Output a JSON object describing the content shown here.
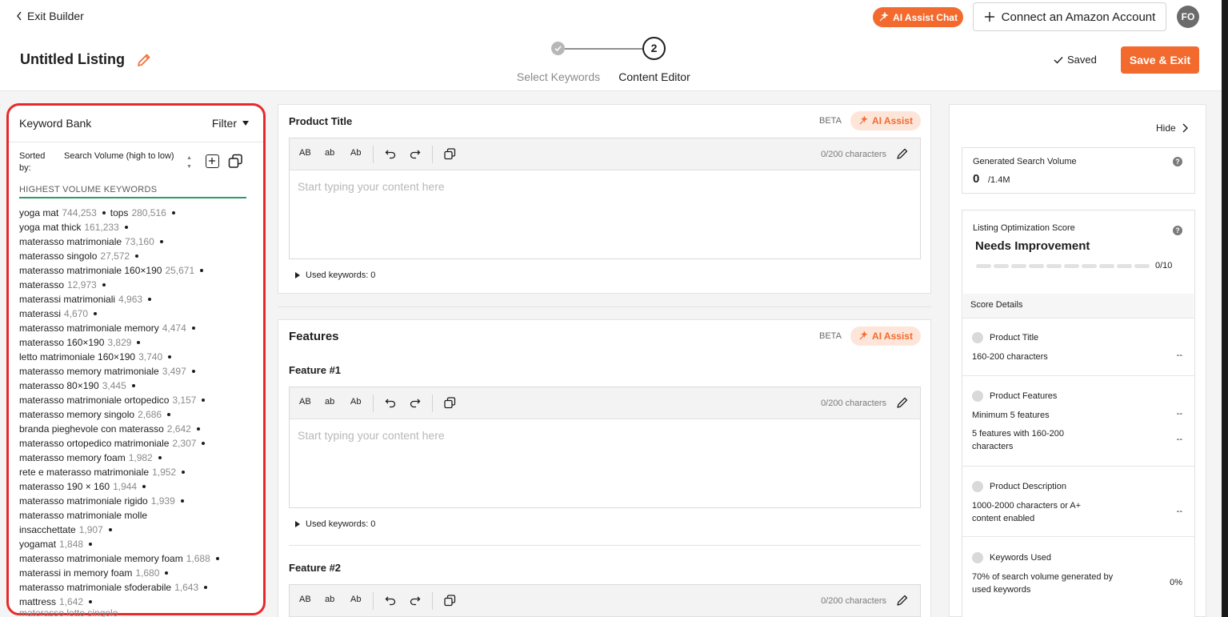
{
  "header": {
    "exit_label": "Exit Builder",
    "listing_title": "Untitled Listing",
    "steps": [
      {
        "label": "Select Keywords"
      },
      {
        "label": "Content Editor",
        "number": "2"
      }
    ],
    "ai_chat_label": "AI Assist Chat",
    "connect_label": "Connect an Amazon Account",
    "avatar_initials": "FO",
    "saved_label": "Saved",
    "save_exit_label": "Save & Exit"
  },
  "colors": {
    "accent": "#f26a2e",
    "highlight_border": "#e8292c",
    "green_rule": "#2e9a6a"
  },
  "keyword_bank": {
    "title": "Keyword Bank",
    "filter_label": "Filter",
    "sorted_by_label": "Sorted by:",
    "sorted_by_value": "Search Volume (high to low)",
    "section_label": "HIGHEST VOLUME KEYWORDS",
    "rows": [
      [
        {
          "kw": "yoga mat",
          "vol": "744,253"
        },
        {
          "kw": "tops",
          "vol": "280,516"
        }
      ],
      [
        {
          "kw": "yoga mat thick",
          "vol": "161,233"
        }
      ],
      [
        {
          "kw": "materasso matrimoniale",
          "vol": "73,160"
        }
      ],
      [
        {
          "kw": "materasso singolo",
          "vol": "27,572"
        }
      ],
      [
        {
          "kw": "materasso matrimoniale 160×190",
          "vol": "25,671"
        }
      ],
      [
        {
          "kw": "materasso",
          "vol": "12,973"
        }
      ],
      [
        {
          "kw": "materassi matrimoniali",
          "vol": "4,963"
        }
      ],
      [
        {
          "kw": "materassi",
          "vol": "4,670"
        }
      ],
      [
        {
          "kw": "materasso matrimoniale memory",
          "vol": "4,474"
        }
      ],
      [
        {
          "kw": "materasso 160×190",
          "vol": "3,829"
        }
      ],
      [
        {
          "kw": "letto matrimoniale 160×190",
          "vol": "3,740"
        }
      ],
      [
        {
          "kw": "materasso memory matrimoniale",
          "vol": "3,497"
        }
      ],
      [
        {
          "kw": "materasso 80×190",
          "vol": "3,445"
        }
      ],
      [
        {
          "kw": "materasso matrimoniale ortopedico",
          "vol": "3,157"
        }
      ],
      [
        {
          "kw": "materasso memory singolo",
          "vol": "2,686"
        }
      ],
      [
        {
          "kw": "branda pieghevole con materasso",
          "vol": "2,642"
        }
      ],
      [
        {
          "kw": "materasso ortopedico matrimoniale",
          "vol": "2,307"
        }
      ],
      [
        {
          "kw": "materasso memory foam",
          "vol": "1,982"
        }
      ],
      [
        {
          "kw": "rete e materasso matrimoniale",
          "vol": "1,952"
        }
      ],
      [
        {
          "kw": "materasso 190 × 160",
          "vol": "1,944"
        }
      ],
      [
        {
          "kw": "materasso matrimoniale rigido",
          "vol": "1,939"
        }
      ],
      [
        {
          "kw": "materasso matrimoniale molle",
          "vol": ""
        }
      ],
      [
        {
          "kw": "insacchettate",
          "vol": "1,907"
        }
      ],
      [
        {
          "kw": "yogamat",
          "vol": "1,848"
        }
      ],
      [
        {
          "kw": "materasso matrimoniale memory foam",
          "vol": "1,688"
        }
      ],
      [
        {
          "kw": "materassi in memory foam",
          "vol": "1,680"
        }
      ],
      [
        {
          "kw": "materasso matrimoniale sfoderabile",
          "vol": "1,643"
        }
      ],
      [
        {
          "kw": "mattress",
          "vol": "1,642"
        }
      ]
    ],
    "cut_off_text": "materasso letto singolo"
  },
  "editor": {
    "toolbar": {
      "upper": "AB",
      "lower": "ab",
      "title": "Ab"
    },
    "char_count": "0/200 characters",
    "placeholder": "Start typing your content here",
    "used_keywords": "Used keywords: 0",
    "beta": "BETA",
    "ai_assist": "AI Assist",
    "product_title": "Product Title",
    "features": "Features",
    "feature1": "Feature #1",
    "feature2": "Feature #2"
  },
  "right_panel": {
    "hide_label": "Hide",
    "gsv_label": "Generated Search Volume",
    "gsv_value": "0",
    "gsv_total": "/1.4M",
    "los_label": "Listing Optimization Score",
    "los_status": "Needs Improvement",
    "los_score": "0/10",
    "score_details_label": "Score Details",
    "details": [
      {
        "title": "Product Title",
        "reqs": [
          {
            "text": "160-200 characters",
            "value": "--"
          }
        ]
      },
      {
        "title": "Product Features",
        "reqs": [
          {
            "text": "Minimum 5 features",
            "value": "--"
          },
          {
            "text": "5 features with 160-200 characters",
            "value": "--"
          }
        ]
      },
      {
        "title": "Product Description",
        "reqs": [
          {
            "text": "1000-2000 characters or A+ content enabled",
            "value": "--"
          }
        ]
      },
      {
        "title": "Keywords Used",
        "reqs": [
          {
            "text": "70% of search volume generated by used keywords",
            "value": "0%"
          }
        ]
      }
    ]
  }
}
